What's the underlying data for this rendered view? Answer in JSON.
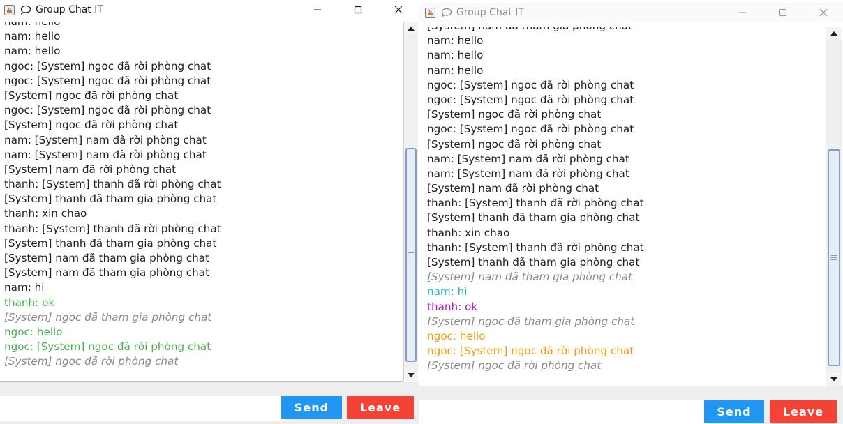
{
  "colors": {
    "system_gray": "#8a8a8a",
    "green": "#4caf50",
    "cyan": "#22b8c8",
    "purple": "#9c27b0",
    "orange": "#f29c11",
    "default": "#202020",
    "send_button": "#2196f3",
    "leave_button": "#f44336"
  },
  "left_window": {
    "title": "Group Chat IT",
    "send_label": "Send",
    "leave_label": "Leave",
    "input_value": "",
    "messages": [
      {
        "text": "nam: hello",
        "style": "default"
      },
      {
        "text": "nam: hello",
        "style": "default"
      },
      {
        "text": "nam: hello",
        "style": "default"
      },
      {
        "text": "ngoc: [System] ngoc đã rời phòng chat",
        "style": "default"
      },
      {
        "text": "ngoc: [System] ngoc đã rời phòng chat",
        "style": "default"
      },
      {
        "text": "[System] ngoc đã rời phòng chat",
        "style": "default"
      },
      {
        "text": "ngoc: [System] ngoc đã rời phòng chat",
        "style": "default"
      },
      {
        "text": "[System] ngoc đã rời phòng chat",
        "style": "default"
      },
      {
        "text": "nam: [System] nam đã rời phòng chat",
        "style": "default"
      },
      {
        "text": "nam: [System] nam đã rời phòng chat",
        "style": "default"
      },
      {
        "text": "[System] nam đã rời phòng chat",
        "style": "default"
      },
      {
        "text": "thanh: [System] thanh đã rời phòng chat",
        "style": "default"
      },
      {
        "text": "[System] thanh đã tham gia phòng chat",
        "style": "default"
      },
      {
        "text": "thanh: xin chao",
        "style": "default"
      },
      {
        "text": "thanh: [System] thanh đã rời phòng chat",
        "style": "default"
      },
      {
        "text": "[System] thanh đã tham gia phòng chat",
        "style": "default"
      },
      {
        "text": "[System] nam đã tham gia phòng chat",
        "style": "default"
      },
      {
        "text": "[System] nam đã tham gia phòng chat",
        "style": "default"
      },
      {
        "text": "nam: hi",
        "style": "default"
      },
      {
        "text": "thanh: ok",
        "style": "green"
      },
      {
        "text": "[System] ngoc đã tham gia phòng chat",
        "style": "system"
      },
      {
        "text": "ngoc: hello",
        "style": "green"
      },
      {
        "text": "ngoc: [System] ngoc đã rời phòng chat",
        "style": "green"
      },
      {
        "text": "[System] ngoc đã rời phòng chat",
        "style": "system"
      }
    ],
    "scroll_thumb_fraction": {
      "start": 0.34,
      "end": 0.98
    }
  },
  "right_window": {
    "title": "Group Chat IT",
    "send_label": "Send",
    "leave_label": "Leave",
    "input_value": "",
    "messages": [
      {
        "text": "[System] nam đã tham gia phòng chat",
        "style": "default"
      },
      {
        "text": "nam: hello",
        "style": "default"
      },
      {
        "text": "nam: hello",
        "style": "default"
      },
      {
        "text": "nam: hello",
        "style": "default"
      },
      {
        "text": "ngoc: [System] ngoc đã rời phòng chat",
        "style": "default"
      },
      {
        "text": "ngoc: [System] ngoc đã rời phòng chat",
        "style": "default"
      },
      {
        "text": "[System] ngoc đã rời phòng chat",
        "style": "default"
      },
      {
        "text": "ngoc: [System] ngoc đã rời phòng chat",
        "style": "default"
      },
      {
        "text": "[System] ngoc đã rời phòng chat",
        "style": "default"
      },
      {
        "text": "nam: [System] nam đã rời phòng chat",
        "style": "default"
      },
      {
        "text": "nam: [System] nam đã rời phòng chat",
        "style": "default"
      },
      {
        "text": "[System] nam đã rời phòng chat",
        "style": "default"
      },
      {
        "text": "thanh: [System] thanh đã rời phòng chat",
        "style": "default"
      },
      {
        "text": "[System] thanh đã tham gia phòng chat",
        "style": "default"
      },
      {
        "text": "thanh: xin chao",
        "style": "default"
      },
      {
        "text": "thanh: [System] thanh đã rời phòng chat",
        "style": "default"
      },
      {
        "text": "[System] thanh đã tham gia phòng chat",
        "style": "default"
      },
      {
        "text": "[System] nam đã tham gia phòng chat",
        "style": "system"
      },
      {
        "text": "nam: hi",
        "style": "cyan"
      },
      {
        "text": "thanh: ok",
        "style": "purple"
      },
      {
        "text": "[System] ngoc đã tham gia phòng chat",
        "style": "system"
      },
      {
        "text": "ngoc: hello",
        "style": "orange"
      },
      {
        "text": "ngoc: [System] ngoc đã rời phòng chat",
        "style": "orange"
      },
      {
        "text": "[System] ngoc đã rời phòng chat",
        "style": "system"
      }
    ],
    "scroll_thumb_fraction": {
      "start": 0.33,
      "end": 0.98
    }
  }
}
